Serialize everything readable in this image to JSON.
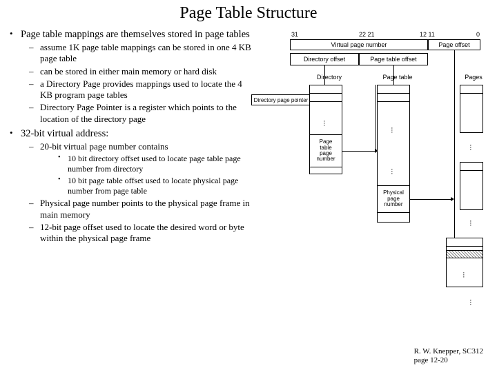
{
  "title": "Page Table Structure",
  "bullets": {
    "b1": "Page table mappings are themselves stored in page tables",
    "b1_sub": [
      "assume 1K page table mappings can be stored in one 4 KB page table",
      "can be stored in either main memory or hard disk",
      "a Directory Page provides mappings used to locate the 4 KB program page tables",
      "Directory Page Pointer is a register which points to the location of the directory page"
    ],
    "b2": "32-bit virtual address:",
    "b2_sub1": "20-bit virtual page number contains",
    "b2_sub1_sub": [
      "10 bit directory offset used to locate page table page number from directory",
      "10 bit page table offset used to locate physical page number from page table"
    ],
    "b2_sub2": "Physical page number points to the physical page frame in main memory",
    "b2_sub3": "12-bit page offset used to locate the desired word or byte within the physical page frame"
  },
  "diagram": {
    "bits": {
      "b31": "31",
      "b22": "22",
      "b21": "21",
      "b12": "12",
      "b11": "11",
      "b0": "0"
    },
    "vpn": "Virtual page number",
    "po": "Page offset",
    "doff": "Directory offset",
    "ptoff": "Page table offset",
    "dpp": "Directory page pointer",
    "dir": "Directory",
    "pt": "Page table",
    "pages": "Pages",
    "ptpn": "Page\ntable\npage\nnumber",
    "ppn": "Physical\npage\nnumber"
  },
  "footer": {
    "l1": "R. W. Knepper, SC312",
    "l2": "page 12-20"
  }
}
